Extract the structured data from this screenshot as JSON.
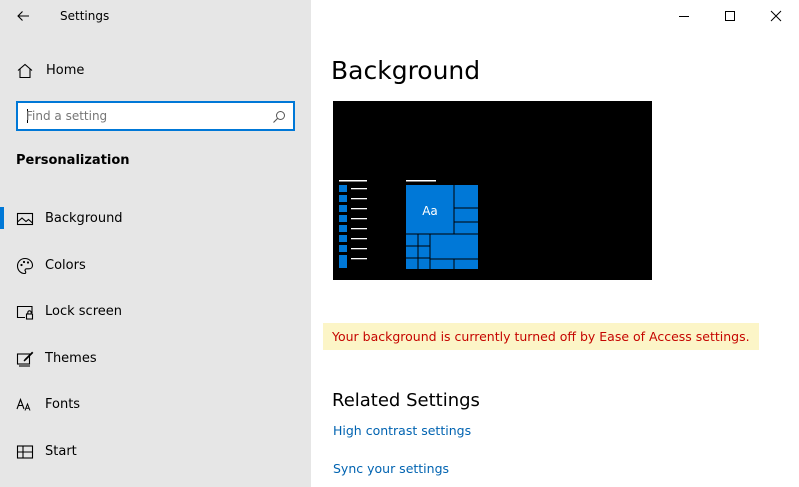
{
  "app": {
    "title": "Settings"
  },
  "sidebar": {
    "home_label": "Home",
    "search_placeholder": "Find a setting",
    "section_title": "Personalization",
    "items": [
      {
        "label": "Background",
        "icon": "picture-icon",
        "selected": true
      },
      {
        "label": "Colors",
        "icon": "palette-icon",
        "selected": false
      },
      {
        "label": "Lock screen",
        "icon": "lock-screen-icon",
        "selected": false
      },
      {
        "label": "Themes",
        "icon": "brush-icon",
        "selected": false
      },
      {
        "label": "Fonts",
        "icon": "font-icon",
        "selected": false
      },
      {
        "label": "Start",
        "icon": "start-icon",
        "selected": false
      }
    ]
  },
  "main": {
    "title": "Background",
    "preview_tile_label": "Aa",
    "warning": "Your background is currently turned off by Ease of Access settings.",
    "related_title": "Related Settings",
    "links": [
      "High contrast settings",
      "Sync your settings"
    ]
  },
  "colors": {
    "accent": "#0078d7",
    "sidebar_bg": "#e6e6e6",
    "warning_bg": "#fcf5c7",
    "warning_text": "#c50500",
    "link": "#0063b1"
  }
}
